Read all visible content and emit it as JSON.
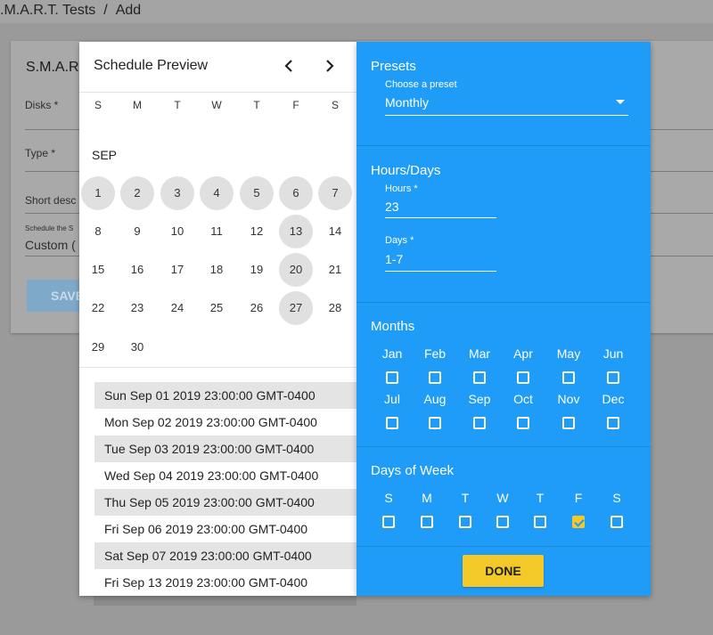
{
  "breadcrumb": {
    "parent": ".M.A.R.T. Tests",
    "separator": "/",
    "current": "Add"
  },
  "background_form": {
    "title": "S.M.A.R.",
    "disks_label": "Disks *",
    "type_label": "Type *",
    "short_desc_label": "Short desc",
    "schedule_label": "Schedule the S",
    "schedule_value": "Custom (",
    "save_label": "SAVE"
  },
  "schedule_preview": {
    "title": "Schedule Preview",
    "prev_icon": "chevron-left-icon",
    "next_icon": "chevron-right-icon",
    "weekdays": [
      "S",
      "M",
      "T",
      "W",
      "T",
      "F",
      "S"
    ],
    "month": "SEP",
    "weeks": [
      [
        "",
        "",
        "",
        "",
        "",
        "",
        ""
      ],
      [
        "1",
        "2",
        "3",
        "4",
        "5",
        "6",
        "7"
      ],
      [
        "8",
        "9",
        "10",
        "11",
        "12",
        "13",
        "14"
      ],
      [
        "15",
        "16",
        "17",
        "18",
        "19",
        "20",
        "21"
      ],
      [
        "22",
        "23",
        "24",
        "25",
        "26",
        "27",
        "28"
      ],
      [
        "29",
        "30",
        "",
        "",
        "",
        "",
        ""
      ]
    ],
    "highlighted_days": [
      "1",
      "2",
      "3",
      "4",
      "5",
      "6",
      "7",
      "13",
      "20",
      "27"
    ],
    "upcoming_runs": [
      "Sun Sep 01 2019 23:00:00 GMT-0400",
      "Mon Sep 02 2019 23:00:00 GMT-0400",
      "Tue Sep 03 2019 23:00:00 GMT-0400",
      "Wed Sep 04 2019 23:00:00 GMT-0400",
      "Thu Sep 05 2019 23:00:00 GMT-0400",
      "Fri Sep 06 2019 23:00:00 GMT-0400",
      "Sat Sep 07 2019 23:00:00 GMT-0400",
      "Fri Sep 13 2019 23:00:00 GMT-0400"
    ]
  },
  "presets": {
    "title": "Presets",
    "select_label": "Choose a preset",
    "selected": "Monthly"
  },
  "hours_days": {
    "title": "Hours/Days",
    "hours_label": "Hours *",
    "hours_value": "23",
    "days_label": "Days *",
    "days_value": "1-7"
  },
  "months": {
    "title": "Months",
    "names": [
      "Jan",
      "Feb",
      "Mar",
      "Apr",
      "May",
      "Jun",
      "Jul",
      "Aug",
      "Sep",
      "Oct",
      "Nov",
      "Dec"
    ],
    "checked": []
  },
  "days_of_week": {
    "title": "Days of Week",
    "names": [
      "S",
      "M",
      "T",
      "W",
      "T",
      "F",
      "S"
    ],
    "checked_index": [
      5
    ]
  },
  "done_label": "DONE",
  "colors": {
    "panel_blue": "#1e9cf7",
    "accent_yellow": "#f2c928",
    "selected_day_gray": "#e0e0e0"
  }
}
